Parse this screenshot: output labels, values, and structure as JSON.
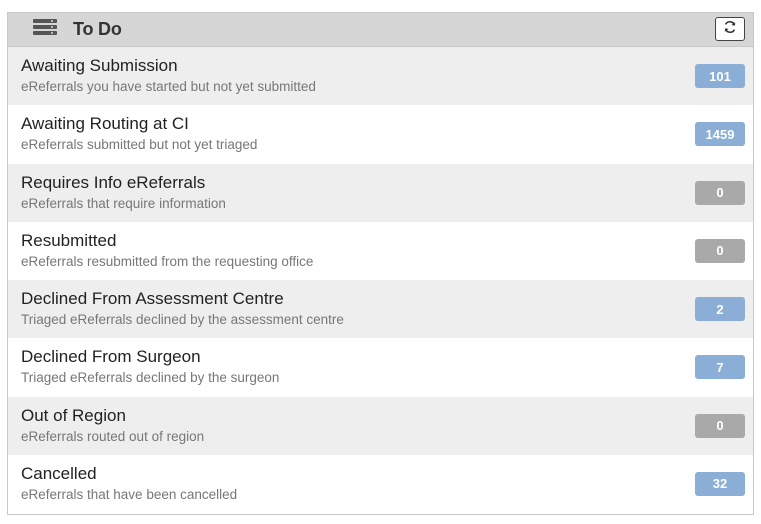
{
  "header": {
    "title": "To Do",
    "icon": "list-icon",
    "refresh_icon": "refresh-icon"
  },
  "colors": {
    "badge_active": "#8aaed6",
    "badge_zero": "#a9a9a9",
    "header_bg": "#d6d6d6"
  },
  "items": [
    {
      "label": "Awaiting Submission",
      "description": "eReferrals you have started but not yet submitted",
      "count": "101",
      "zero": false
    },
    {
      "label": "Awaiting Routing at CI",
      "description": "eReferrals submitted but not yet triaged",
      "count": "1459",
      "zero": false
    },
    {
      "label": "Requires Info eReferrals",
      "description": "eReferrals that require information",
      "count": "0",
      "zero": true
    },
    {
      "label": "Resubmitted",
      "description": "eReferrals resubmitted from the requesting office",
      "count": "0",
      "zero": true
    },
    {
      "label": "Declined From Assessment Centre",
      "description": "Triaged eReferrals declined by the assessment centre",
      "count": "2",
      "zero": false
    },
    {
      "label": "Declined From Surgeon",
      "description": "Triaged eReferrals declined by the surgeon",
      "count": "7",
      "zero": false
    },
    {
      "label": "Out of Region",
      "description": "eReferrals routed out of region",
      "count": "0",
      "zero": true
    },
    {
      "label": "Cancelled",
      "description": "eReferrals that have been cancelled",
      "count": "32",
      "zero": false
    }
  ]
}
